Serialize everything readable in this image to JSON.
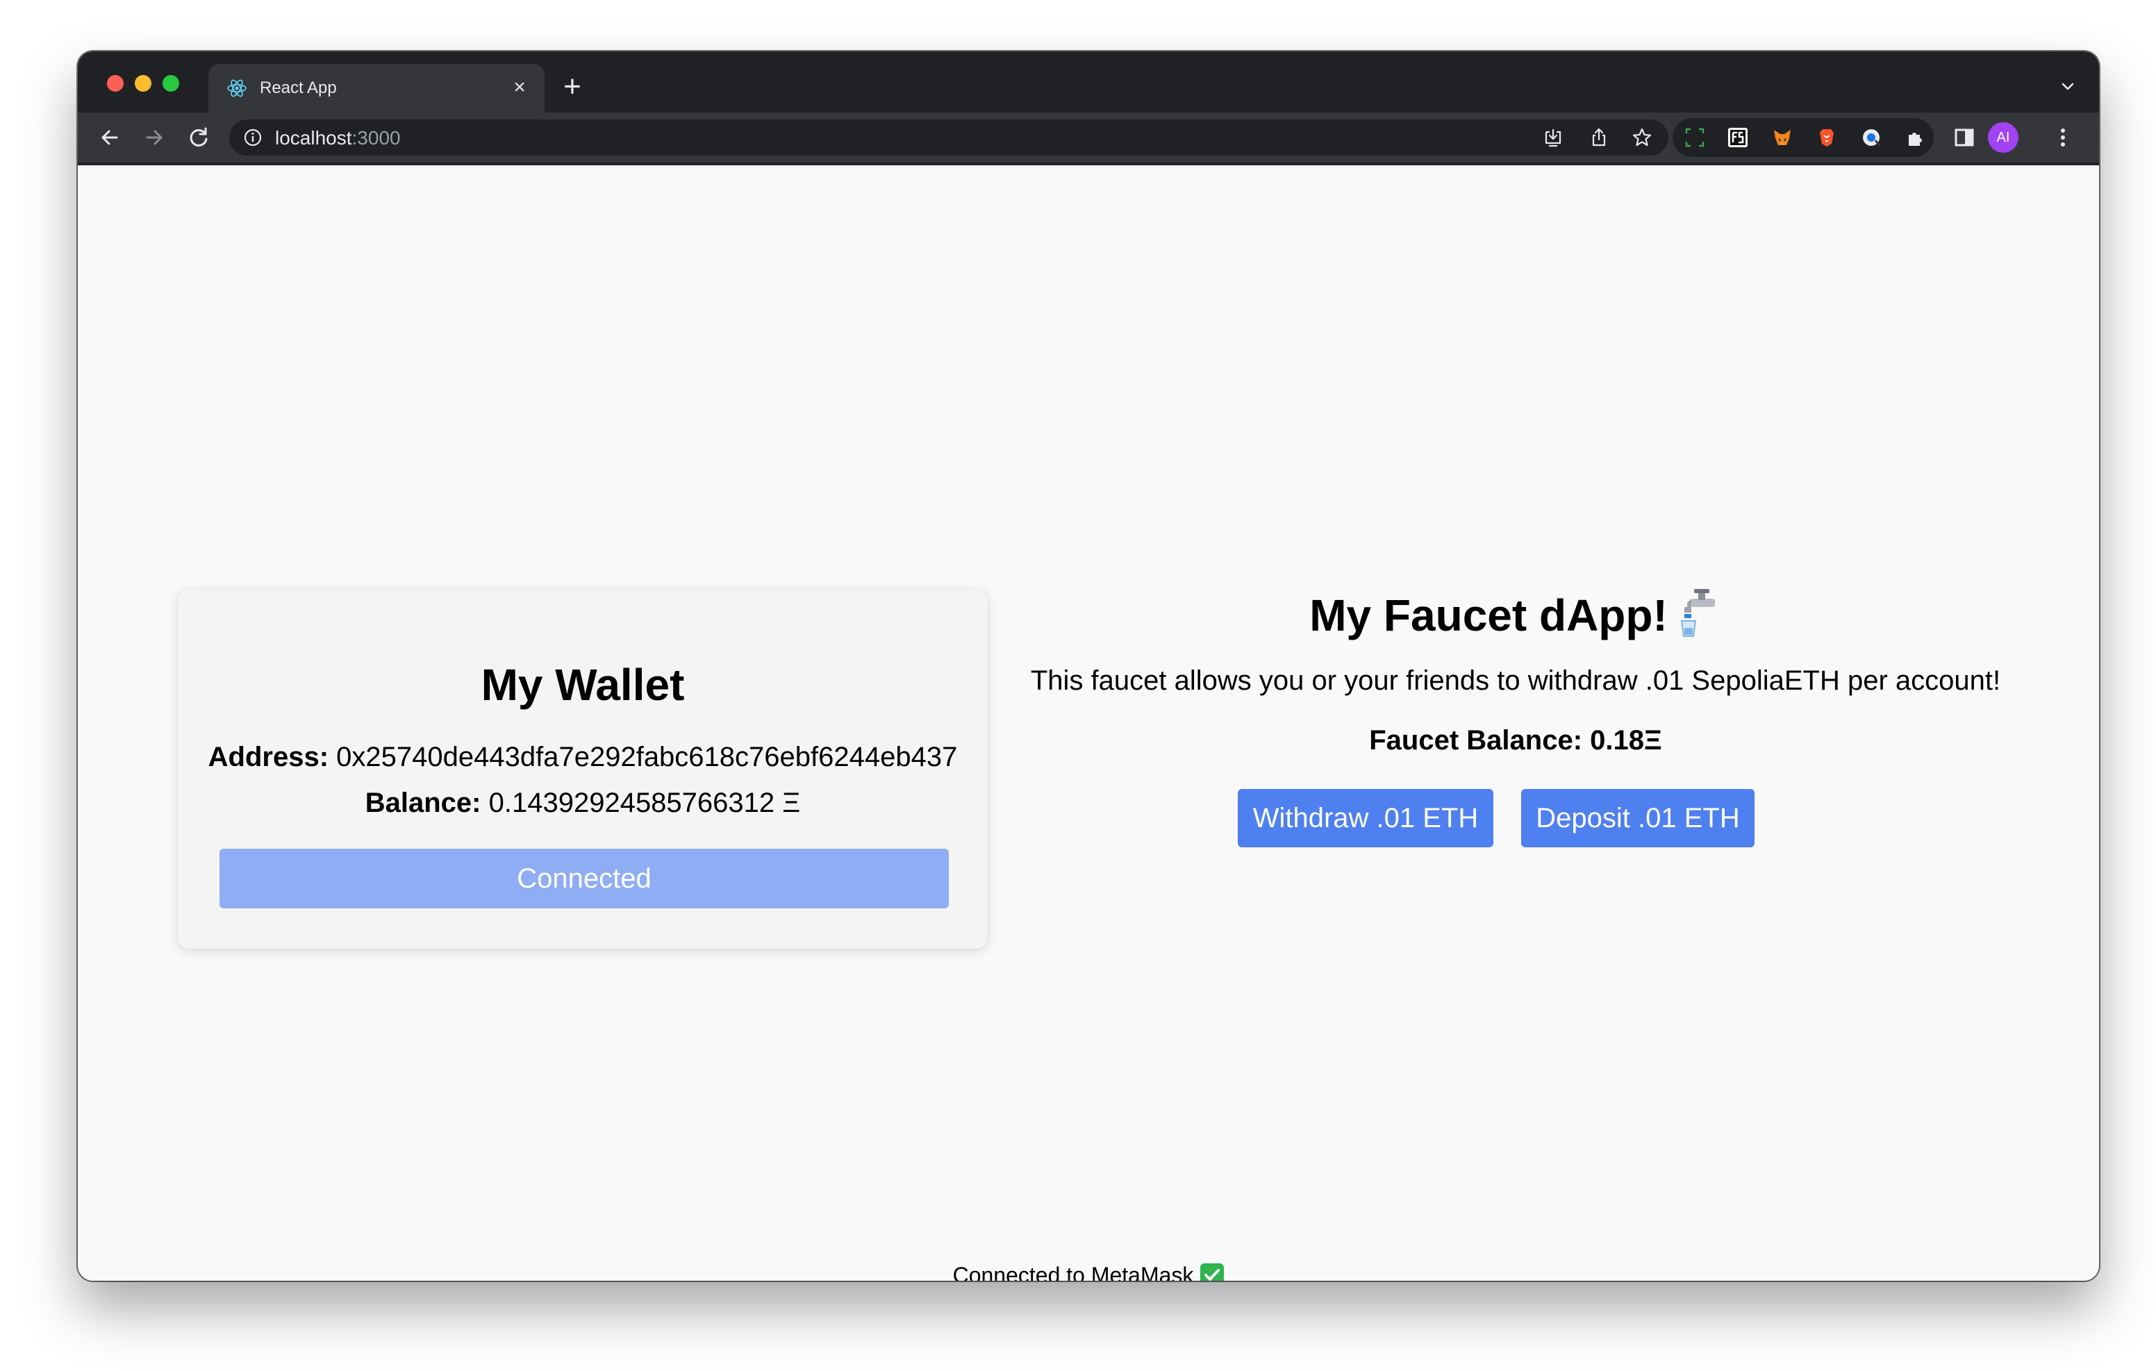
{
  "browser": {
    "tab": {
      "title": "React App"
    },
    "address_bar": {
      "host": "localhost",
      "port": ":3000"
    },
    "profile_initials": "AI"
  },
  "wallet": {
    "title": "My Wallet",
    "address_label": "Address:",
    "address_value": "0x25740de443dfa7e292fabc618c76ebf6244eb437",
    "balance_label": "Balance:",
    "balance_value": "0.14392924585766312 Ξ",
    "connect_button_label": "Connected"
  },
  "faucet": {
    "title": "My Faucet dApp!",
    "description": "This faucet allows you or your friends to withdraw .01 SepoliaETH per account!",
    "balance_label": "Faucet Balance: 0.18Ξ",
    "withdraw_label": "Withdraw .01 ETH",
    "deposit_label": "Deposit .01 ETH"
  },
  "footer": {
    "status": "Connected to MetaMask"
  },
  "colors": {
    "primary_button": "#4f80f0",
    "disabled_button": "#8fadf4",
    "check": "#2fb44e"
  }
}
